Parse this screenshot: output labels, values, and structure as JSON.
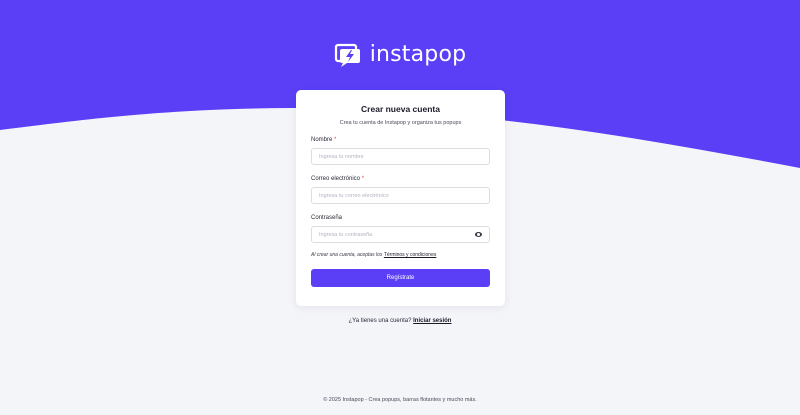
{
  "brand": {
    "name": "instapop",
    "primary_color": "#5a3ff6",
    "logo_icon": "lightning-bubble-icon"
  },
  "card": {
    "title": "Crear nueva cuenta",
    "subtitle": "Crea tu cuenta de Instapop y organiza tus popups",
    "name_label": "Nombre",
    "name_placeholder": "Ingresa tu nombre",
    "email_label": "Correo electrónico",
    "email_placeholder": "Ingresa tu correo electrónico",
    "password_label": "Contraseña",
    "password_placeholder": "Ingresa tu contraseña",
    "required_mark": "*",
    "terms_prefix": "Al crear una cuenta, aceptas los",
    "terms_link": "Términos y condiciones",
    "submit_label": "Regístrate"
  },
  "login": {
    "prompt": "¿Ya tienes una cuenta?",
    "link": "Iniciar sesión"
  },
  "footer": {
    "text": "© 2025 Instapop - Crea popups, barras flotantes y mucho más."
  }
}
